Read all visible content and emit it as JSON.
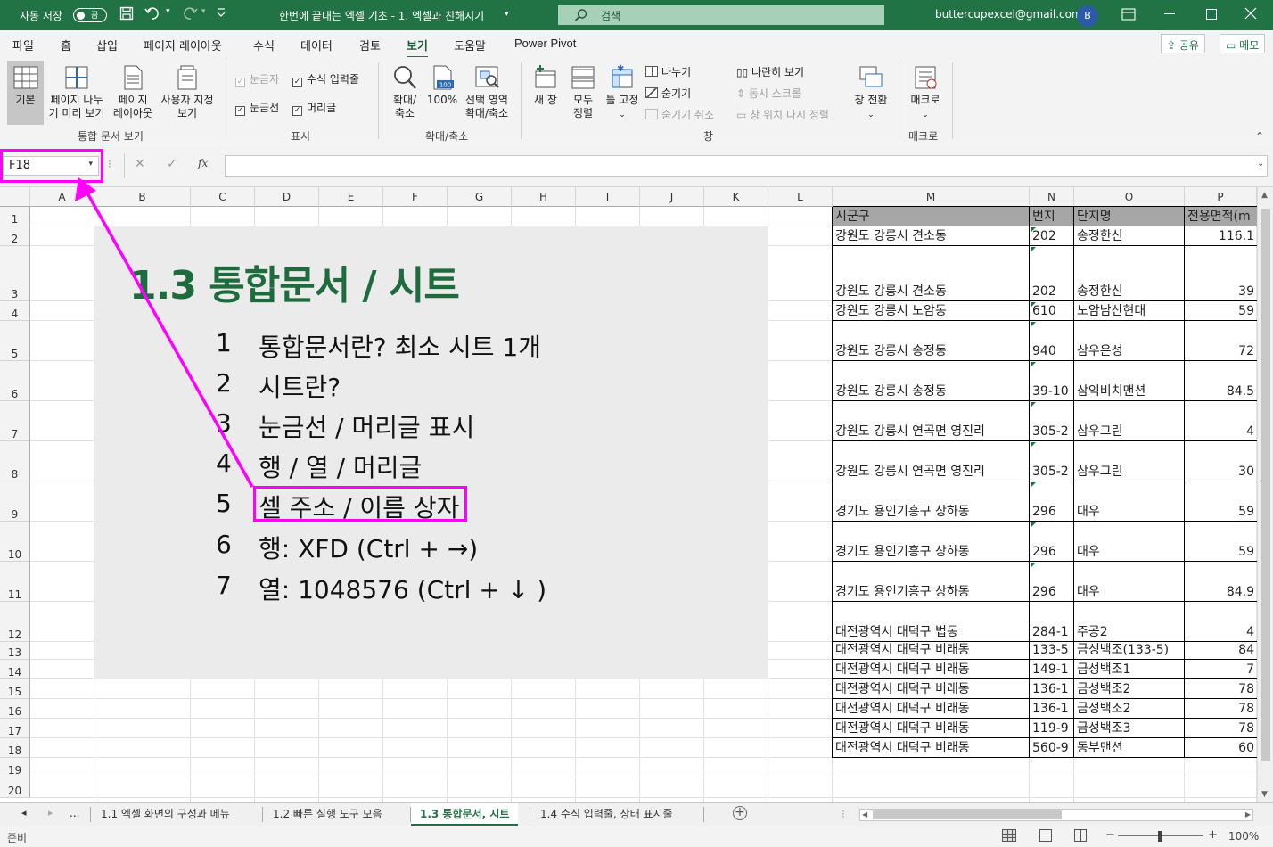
{
  "titlebar": {
    "autosave_label": "자동 저장",
    "autosave_state": "끔",
    "doc_title": "한번에 끝내는 엑셀 기초 - 1. 엑셀과 친해지기",
    "search_placeholder": "검색",
    "email": "buttercupexcel@gmail.com",
    "avatar_initial": "B"
  },
  "menu": {
    "tabs": [
      "파일",
      "홈",
      "삽입",
      "페이지 레이아웃",
      "수식",
      "데이터",
      "검토",
      "보기",
      "도움말",
      "Power Pivot"
    ],
    "active": "보기",
    "share_label": "공유",
    "memo_label": "메모"
  },
  "ribbon": {
    "views": {
      "normal": "기본",
      "pagebreak_1": "페이지 나누",
      "pagebreak_2": "기 미리 보기",
      "pagelayout_1": "페이지",
      "pagelayout_2": "레이아웃",
      "custom_1": "사용자 지정",
      "custom_2": "보기",
      "group": "통합 문서 보기"
    },
    "show": {
      "ruler": "눈금자",
      "formula_bar": "수식 입력줄",
      "gridlines": "눈금선",
      "headings": "머리글",
      "group": "표시"
    },
    "zoom": {
      "zoom_1": "확대/",
      "zoom_2": "축소",
      "z100": "100%",
      "zoom100_icon_text": "100",
      "sel_1": "선택 영역",
      "sel_2": "확대/축소",
      "group": "확대/축소"
    },
    "window": {
      "new": "새 창",
      "arrange_1": "모두",
      "arrange_2": "정렬",
      "freeze": "틀 고정",
      "split": "나누기",
      "hide": "숨기기",
      "unhide": "숨기기 취소",
      "side": "나란히 보기",
      "sync": "동시 스크롤",
      "reset": "창 위치 다시 정렬",
      "switch": "창 전환",
      "group": "창"
    },
    "macro": {
      "label": "매크로",
      "group": "매크로"
    }
  },
  "formula": {
    "namebox": "F18",
    "fx": "fx",
    "value": ""
  },
  "columns": [
    "A",
    "B",
    "C",
    "D",
    "E",
    "F",
    "G",
    "H",
    "I",
    "J",
    "K",
    "L",
    "M",
    "N",
    "O",
    "P"
  ],
  "rows": [
    "1",
    "2",
    "3",
    "4",
    "5",
    "6",
    "7",
    "8",
    "9",
    "10",
    "11",
    "12",
    "13",
    "14",
    "15",
    "16",
    "17",
    "18",
    "19",
    "20"
  ],
  "table": {
    "headers": [
      "시군구",
      "번지",
      "단지명",
      "전용면적(m"
    ],
    "rows": [
      [
        "강원도 강릉시 견소동",
        "202",
        "송정한신",
        "116.1"
      ],
      [
        "강원도 강릉시 견소동",
        "202",
        "송정한신",
        "39"
      ],
      [
        "강원도 강릉시 노암동",
        "610",
        "노암남산현대",
        "59"
      ],
      [
        "강원도 강릉시 송정동",
        "940",
        "삼우은성",
        "72"
      ],
      [
        "강원도 강릉시 송정동",
        "39-10",
        "삼익비치맨션",
        "84.5"
      ],
      [
        "강원도 강릉시 연곡면 영진리",
        "305-2",
        "삼우그린",
        "4"
      ],
      [
        "강원도 강릉시 연곡면 영진리",
        "305-2",
        "삼우그린",
        "30"
      ],
      [
        "경기도 용인기흥구 상하동",
        "296",
        "대우",
        "59"
      ],
      [
        "경기도 용인기흥구 상하동",
        "296",
        "대우",
        "59"
      ],
      [
        "경기도 용인기흥구 상하동",
        "296",
        "대우",
        "84.9"
      ],
      [
        "대전광역시 대덕구 법동",
        "284-1",
        "주공2",
        "4"
      ],
      [
        "대전광역시 대덕구 비래동",
        "133-5",
        "금성백조(133-5)",
        "84"
      ],
      [
        "대전광역시 대덕구 비래동",
        "149-1",
        "금성백조1",
        "7"
      ],
      [
        "대전광역시 대덕구 비래동",
        "136-1",
        "금성백조2",
        "78"
      ],
      [
        "대전광역시 대덕구 비래동",
        "136-1",
        "금성백조2",
        "78"
      ],
      [
        "대전광역시 대덕구 비래동",
        "119-9",
        "금성백조3",
        "78"
      ],
      [
        "대전광역시 대덕구 비래동",
        "560-9",
        "동부맨션",
        "60"
      ]
    ]
  },
  "shape": {
    "title": "1.3 통합문서 / 시트",
    "items": [
      {
        "num": "1",
        "text": "통합문서란? 최소 시트 1개"
      },
      {
        "num": "2",
        "text": "시트란?"
      },
      {
        "num": "3",
        "text": "눈금선 / 머리글 표시"
      },
      {
        "num": "4",
        "text": "행 / 열 / 머리글"
      },
      {
        "num": "5",
        "text": "셀 주소 / 이름 상자"
      },
      {
        "num": "6",
        "text": "행: XFD (Ctrl + →)"
      },
      {
        "num": "7",
        "text": "열: 1048576 (Ctrl + ↓ )"
      }
    ]
  },
  "sheet_tabs": {
    "more": "...",
    "tabs": [
      "1.1 엑셀 화면의 구성과 메뉴",
      "1.2 빠른 실행 도구 모음",
      "1.3 통합문서, 시트",
      "1.4 수식 입력줄, 상태 표시줄"
    ],
    "active": "1.3 통합문서, 시트"
  },
  "status": {
    "ready": "준비",
    "zoom": "100%"
  },
  "colors": {
    "excel_green": "#217346",
    "highlight": "#ff00ff",
    "shape_title": "#1e6b3e"
  }
}
